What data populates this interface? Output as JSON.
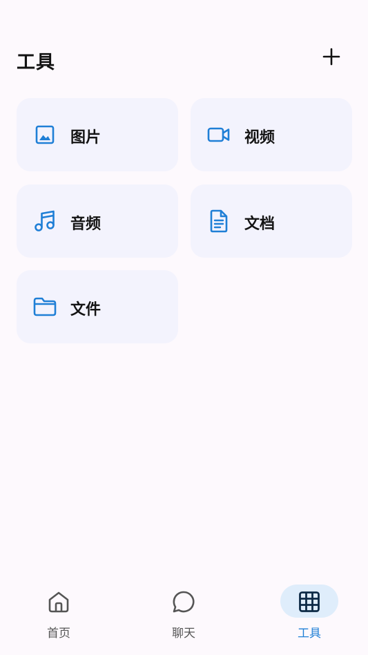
{
  "header": {
    "title": "工具",
    "add_icon": "plus-icon"
  },
  "tools": [
    {
      "label": "图片",
      "icon": "image-icon"
    },
    {
      "label": "视频",
      "icon": "video-camera-icon"
    },
    {
      "label": "音频",
      "icon": "music-note-icon"
    },
    {
      "label": "文档",
      "icon": "document-icon"
    },
    {
      "label": "文件",
      "icon": "folder-icon"
    }
  ],
  "tabbar": {
    "items": [
      {
        "label": "首页",
        "icon": "home-icon",
        "active": false
      },
      {
        "label": "聊天",
        "icon": "chat-bubble-icon",
        "active": false
      },
      {
        "label": "工具",
        "icon": "grid-icon",
        "active": true
      }
    ]
  },
  "colors": {
    "background": "#fdf9fd",
    "tile_background": "#f3f3fd",
    "accent": "#1f7fd6",
    "active_tab_pill": "#dfedfb",
    "text": "#141414"
  }
}
